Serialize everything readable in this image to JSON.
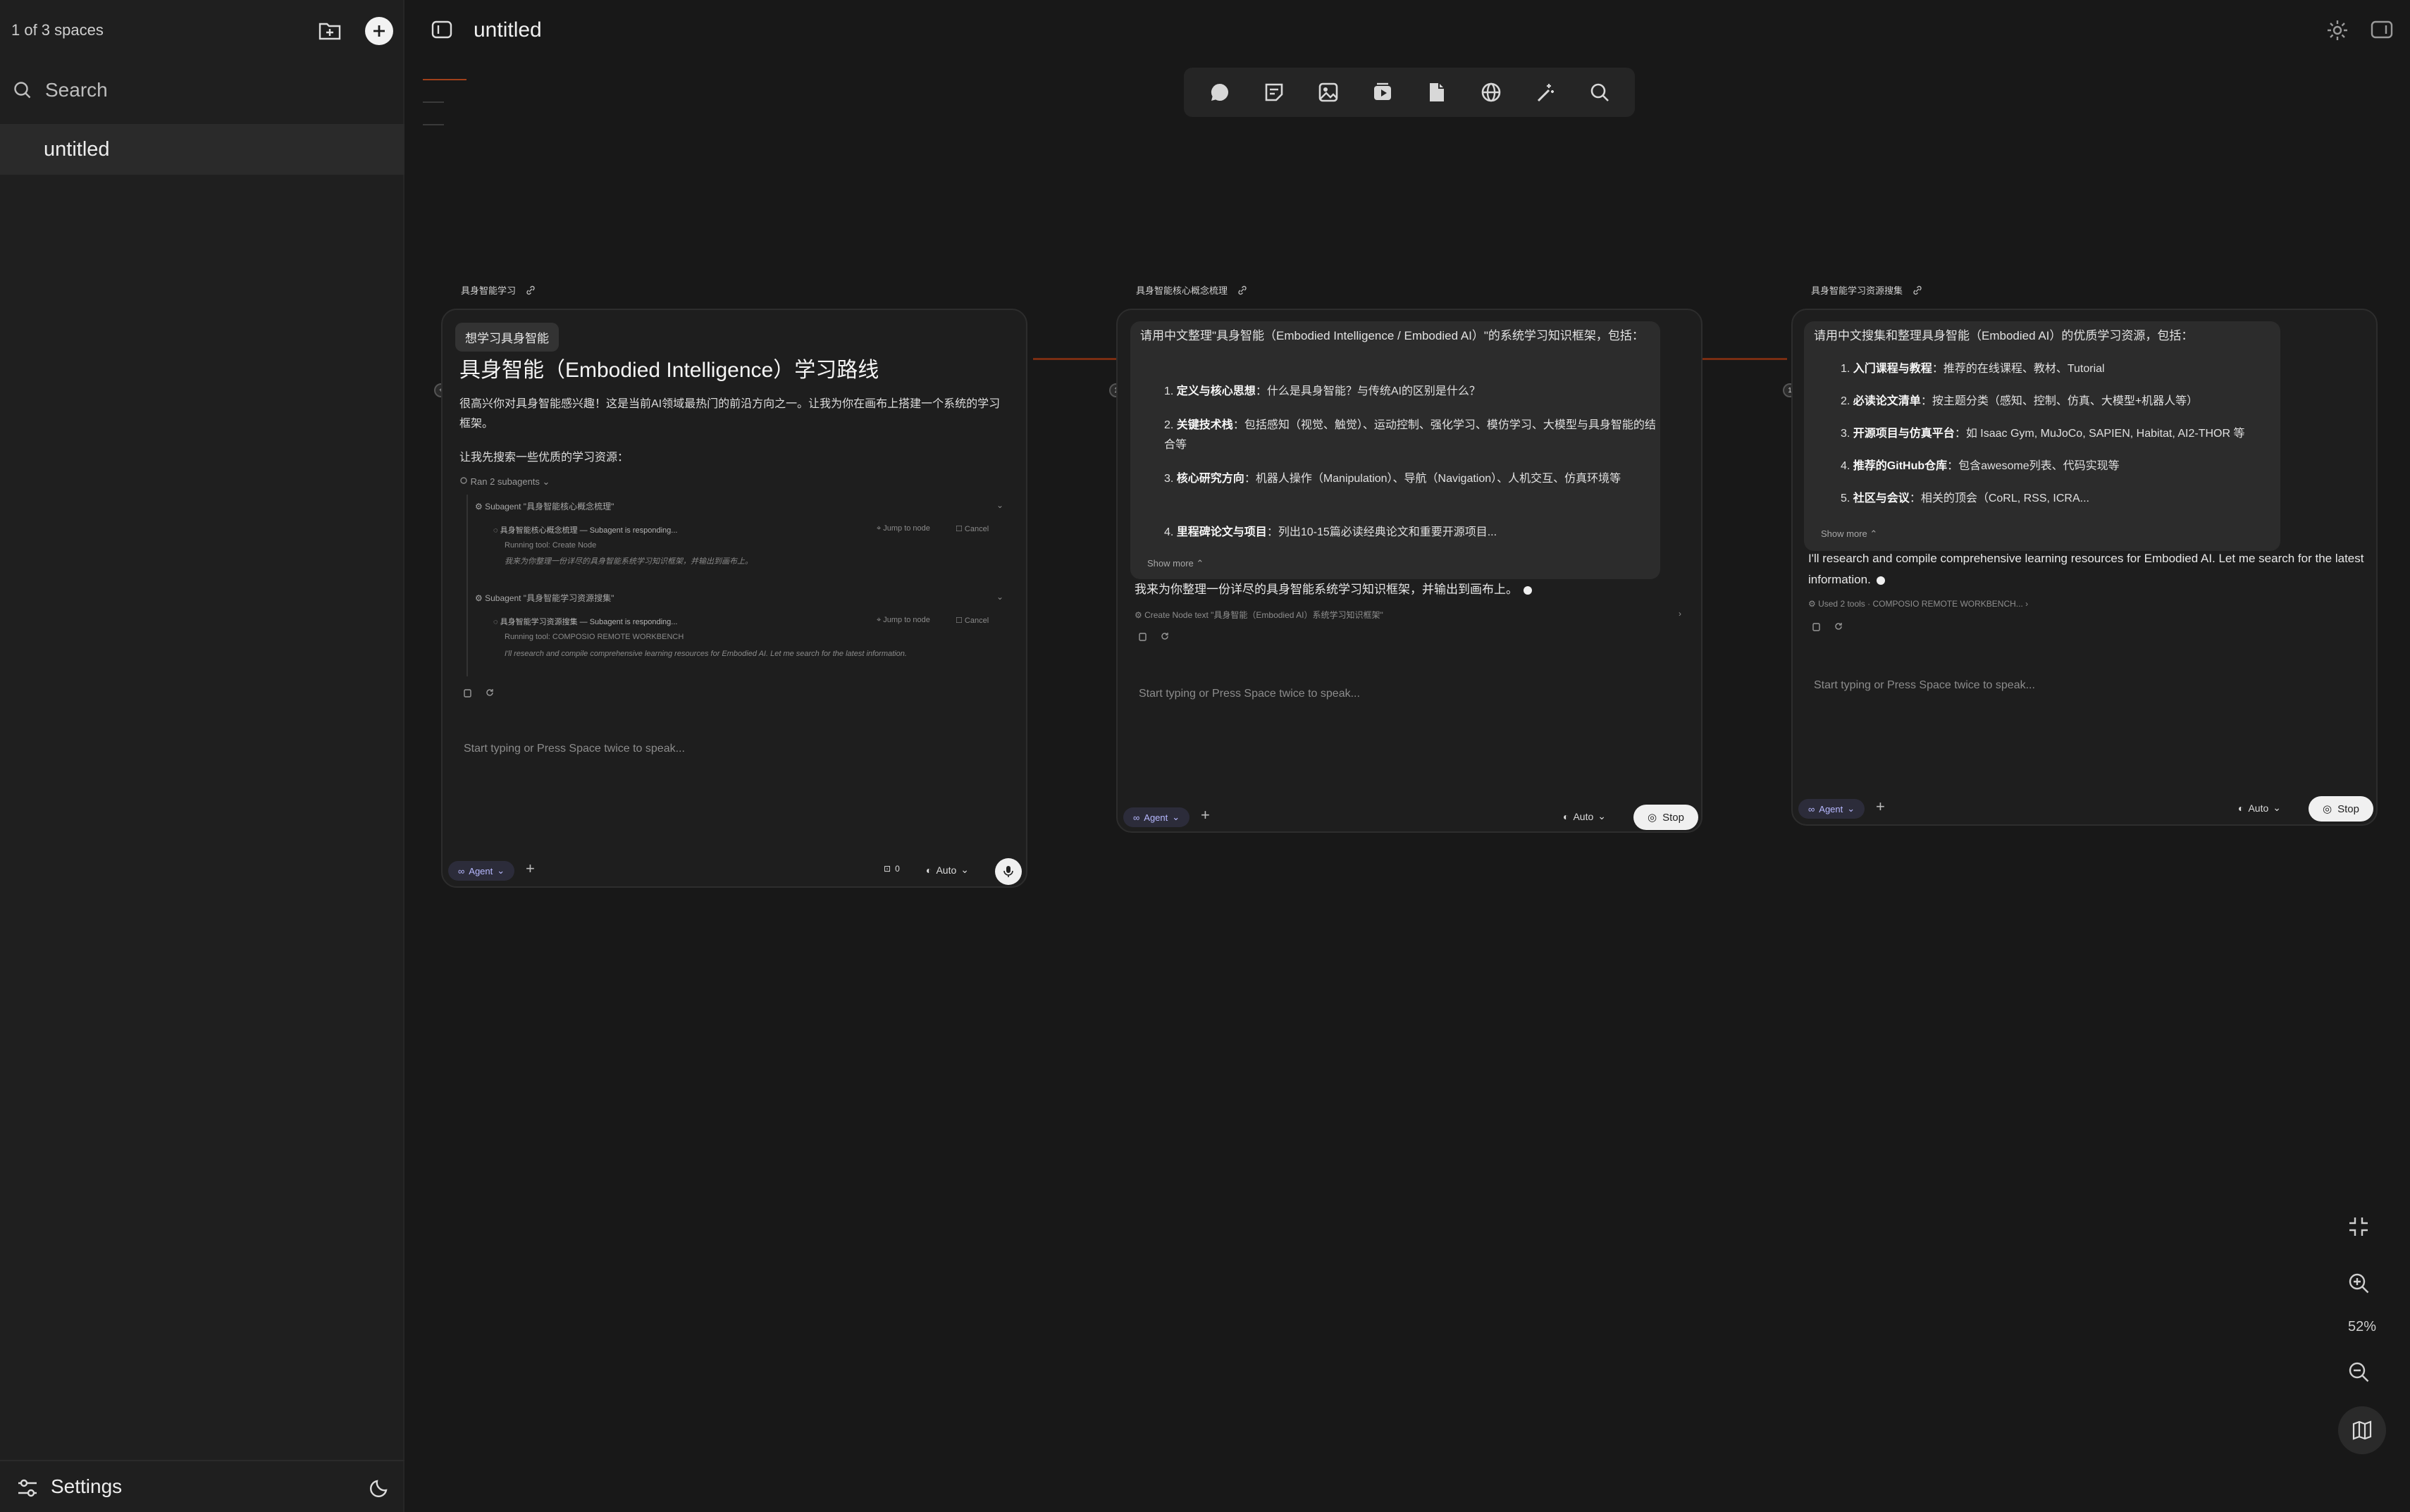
{
  "sidebar": {
    "spaces_count": "1 of 3 spaces",
    "search_placeholder": "Search",
    "items": [
      {
        "label": "untitled"
      }
    ],
    "settings_label": "Settings"
  },
  "header": {
    "title": "untitled"
  },
  "toolbar": {
    "tools": [
      "chat-icon",
      "note-icon",
      "image-icon",
      "video-icon",
      "document-icon",
      "globe-icon",
      "magic-wand-icon",
      "search-icon"
    ]
  },
  "nodes": [
    {
      "label": "具身智能学习",
      "prompt_chip": "想学习具身智能",
      "title": "具身智能（Embodied Intelligence）学习路线",
      "intro": "很高兴你对具身智能感兴趣！这是当前AI领域最热门的前沿方向之一。让我为你在画布上搭建一个系统的学习框架。",
      "lead": "让我先搜索一些优质的学习资源：",
      "ran_subagents": "Ran 2 subagents",
      "subagents": [
        {
          "title": "Subagent \"具身智能核心概念梳理\"",
          "status": "具身智能核心概念梳理 — Subagent is responding...",
          "jump": "Jump to node",
          "cancel": "Cancel",
          "running": "Running tool: Create Node",
          "preview": "我来为你整理一份详尽的具身智能系统学习知识框架，并输出到画布上。"
        },
        {
          "title": "Subagent \"具身智能学习资源搜集\"",
          "status": "具身智能学习资源搜集 — Subagent is responding...",
          "jump": "Jump to node",
          "cancel": "Cancel",
          "running": "Running tool: COMPOSIO REMOTE WORKBENCH",
          "preview": "I'll research and compile comprehensive learning resources for Embodied AI. Let me search for the latest information."
        }
      ],
      "input_placeholder": "Start typing or Press Space twice to speak...",
      "agent_label": "Agent",
      "count": "0",
      "model": "Auto"
    },
    {
      "label": "具身智能核心概念梳理",
      "request": "请用中文整理\"具身智能（Embodied Intelligence / Embodied AI）\"的系统学习知识框架，包括：",
      "items": [
        {
          "num": "1.",
          "bold": "定义与核心思想",
          "text": "：什么是具身智能？与传统AI的区别是什么？"
        },
        {
          "num": "2.",
          "bold": "关键技术栈",
          "text": "：包括感知（视觉、触觉）、运动控制、强化学习、模仿学习、大模型与具身智能的结合等"
        },
        {
          "num": "3.",
          "bold": "核心研究方向",
          "text": "：机器人操作（Manipulation）、导航（Navigation）、人机交互、仿真环境等"
        },
        {
          "num": "4.",
          "bold": "里程碑论文与项目",
          "text": "：列出10-15篇必读经典论文和重要开源项目..."
        }
      ],
      "show_more": "Show more",
      "reply": "我来为你整理一份详尽的具身智能系统学习知识框架，并输出到画布上。",
      "tool_line": "Create Node  text \"具身智能（Embodied AI）系统学习知识框架\"",
      "input_placeholder": "Start typing or Press Space twice to speak...",
      "agent_label": "Agent",
      "model": "Auto",
      "stop_label": "Stop"
    },
    {
      "label": "具身智能学习资源搜集",
      "request": "请用中文搜集和整理具身智能（Embodied AI）的优质学习资源，包括：",
      "items": [
        {
          "num": "1.",
          "bold": "入门课程与教程",
          "text": "：推荐的在线课程、教材、Tutorial"
        },
        {
          "num": "2.",
          "bold": "必读论文清单",
          "text": "：按主题分类（感知、控制、仿真、大模型+机器人等）"
        },
        {
          "num": "3.",
          "bold": "开源项目与仿真平台",
          "text": "：如 Isaac Gym, MuJoCo, SAPIEN, Habitat, AI2-THOR 等"
        },
        {
          "num": "4.",
          "bold": "推荐的GitHub仓库",
          "text": "：包含awesome列表、代码实现等"
        },
        {
          "num": "5.",
          "bold": "社区与会议",
          "text": "：相关的顶会（CoRL, RSS, ICRA..."
        }
      ],
      "show_more": "Show more",
      "reply": "I'll research and compile comprehensive learning resources for Embodied AI. Let me search for the latest information.",
      "tool_line": "Used 2 tools · COMPOSIO REMOTE WORKBENCH...",
      "input_placeholder": "Start typing or Press Space twice to speak...",
      "agent_label": "Agent",
      "model": "Auto",
      "stop_label": "Stop"
    }
  ],
  "zoom": {
    "level": "52%"
  },
  "colors": {
    "accent": "#e0642c",
    "background": "#181818",
    "sidebar": "#1f1f1f"
  }
}
